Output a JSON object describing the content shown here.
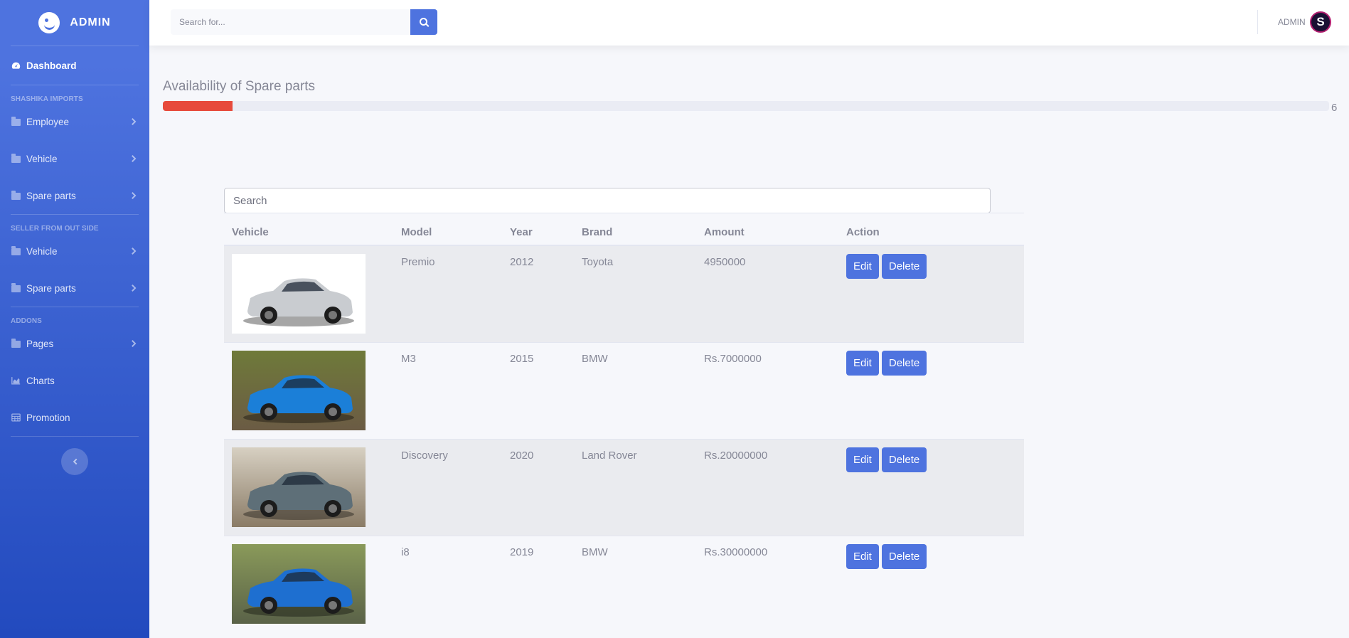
{
  "sidebar": {
    "brand": "ADMIN",
    "dashboard": "Dashboard",
    "heading1": "SHASHIKA IMPORTS",
    "group1": [
      "Employee",
      "Vehicle",
      "Spare parts"
    ],
    "heading2": "SELLER FROM OUT SIDE",
    "group2": [
      "Vehicle",
      "Spare parts"
    ],
    "heading3": "ADDONS",
    "pages": "Pages",
    "charts": "Charts",
    "promotion": "Promotion"
  },
  "topbar": {
    "search_placeholder": "Search for...",
    "user": "ADMIN",
    "avatar_letter": "S"
  },
  "progress": {
    "title": "Availability of Spare parts",
    "value": 6,
    "value_text": "6",
    "fill_fraction": 0.06,
    "fill_color": "#e74a3b"
  },
  "table": {
    "search_placeholder": "Search",
    "headers": {
      "vehicle": "Vehicle",
      "model": "Model",
      "year": "Year",
      "brand": "Brand",
      "amount": "Amount",
      "action": "Action"
    },
    "edit_label": "Edit",
    "delete_label": "Delete",
    "rows": [
      {
        "model": "Premio",
        "year": "2012",
        "brand": "Toyota",
        "amount": "4950000",
        "car_color": "#c9ccd0",
        "bg_top": "#ffffff",
        "bg_bottom": "#ffffff"
      },
      {
        "model": "M3",
        "year": "2015",
        "brand": "BMW",
        "amount": "Rs.7000000",
        "car_color": "#1b7fd8",
        "bg_top": "#6f7a3a",
        "bg_bottom": "#6b5b44"
      },
      {
        "model": "Discovery",
        "year": "2020",
        "brand": "Land Rover",
        "amount": "Rs.20000000",
        "car_color": "#5e6f78",
        "bg_top": "#d7d0c2",
        "bg_bottom": "#8a7b66"
      },
      {
        "model": "i8",
        "year": "2019",
        "brand": "BMW",
        "amount": "Rs.30000000",
        "car_color": "#1e6fd0",
        "bg_top": "#8a9a5a",
        "bg_bottom": "#5a6248"
      }
    ]
  },
  "colors": {
    "primary": "#4e73df",
    "danger": "#e74a3b"
  }
}
